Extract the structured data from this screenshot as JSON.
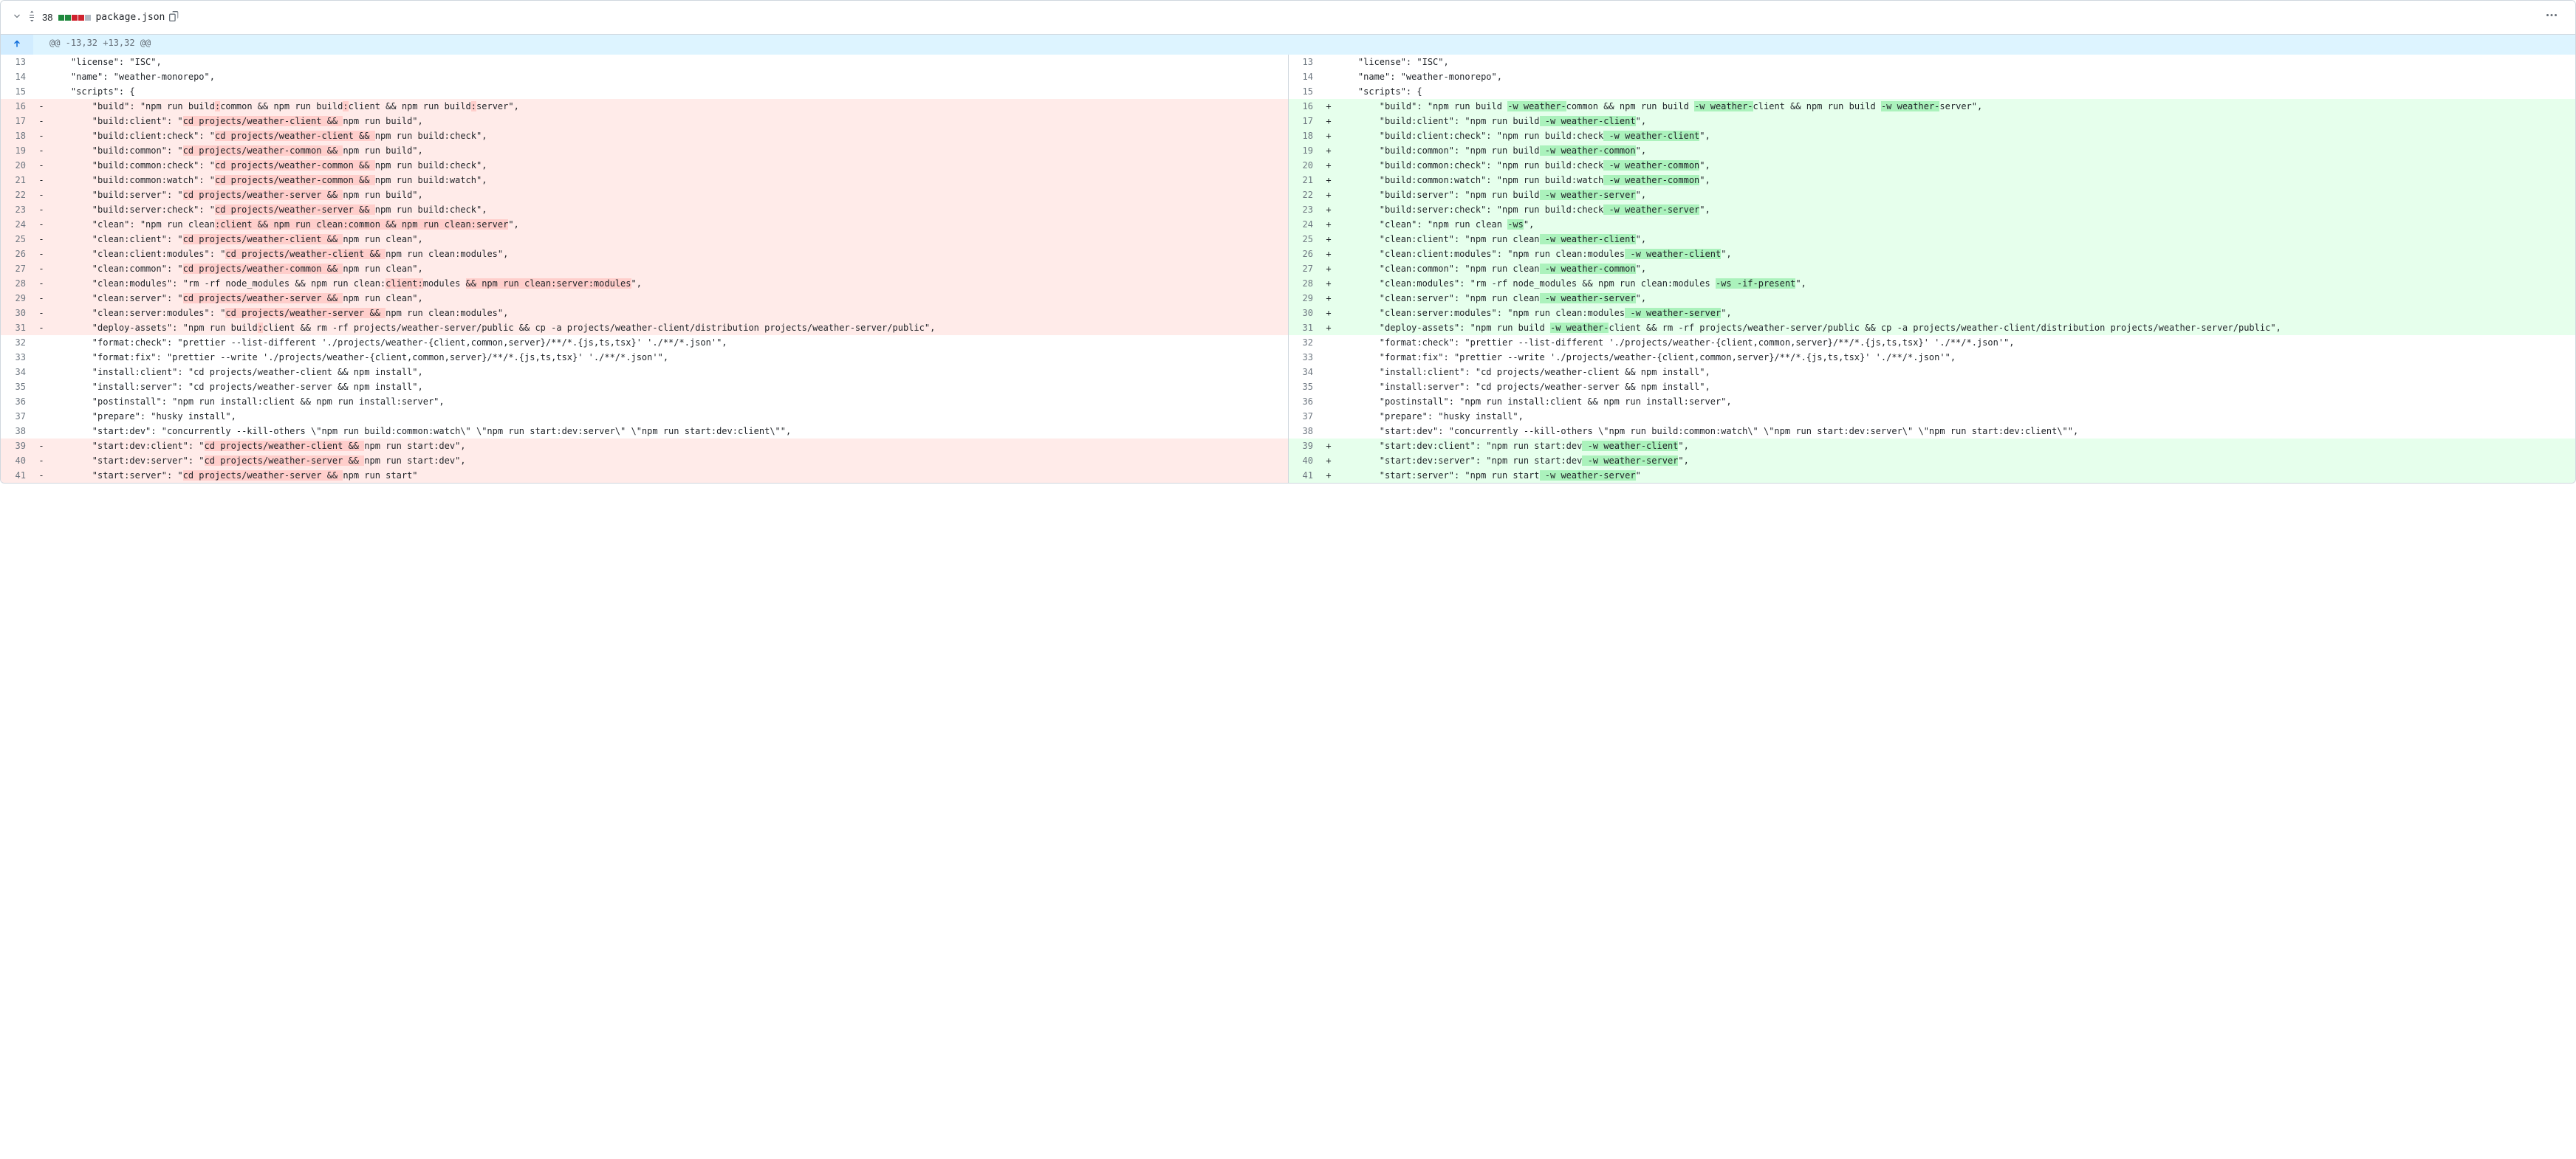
{
  "file": {
    "name": "package.json",
    "changeCount": "38"
  },
  "hunk": {
    "header": "@@ -13,32 +13,32 @@",
    "left": [
      {
        "n": "13",
        "t": "ctx",
        "segs": [
          {
            "t": "    \"license\": \"ISC\","
          }
        ]
      },
      {
        "n": "14",
        "t": "ctx",
        "segs": [
          {
            "t": "    \"name\": \"weather-monorepo\","
          }
        ]
      },
      {
        "n": "15",
        "t": "ctx",
        "segs": [
          {
            "t": "    \"scripts\": {"
          }
        ]
      },
      {
        "n": "16",
        "t": "del",
        "segs": [
          {
            "t": "        \"build\": \"npm run build"
          },
          {
            "t": ":",
            "h": true
          },
          {
            "t": "common && npm run build"
          },
          {
            "t": ":",
            "h": true
          },
          {
            "t": "client && npm run build"
          },
          {
            "t": ":",
            "h": true
          },
          {
            "t": "server\","
          }
        ],
        "m": "-"
      },
      {
        "n": "17",
        "t": "del",
        "segs": [
          {
            "t": "        \"build:client\": \""
          },
          {
            "t": "cd projects/weather-client && ",
            "h": true
          },
          {
            "t": "npm run build\","
          }
        ],
        "m": "-"
      },
      {
        "n": "18",
        "t": "del",
        "segs": [
          {
            "t": "        \"build:client:check\": \""
          },
          {
            "t": "cd projects/weather-client && ",
            "h": true
          },
          {
            "t": "npm run build:check\","
          }
        ],
        "m": "-"
      },
      {
        "n": "19",
        "t": "del",
        "segs": [
          {
            "t": "        \"build:common\": \""
          },
          {
            "t": "cd projects/weather-common && ",
            "h": true
          },
          {
            "t": "npm run build\","
          }
        ],
        "m": "-"
      },
      {
        "n": "20",
        "t": "del",
        "segs": [
          {
            "t": "        \"build:common:check\": \""
          },
          {
            "t": "cd projects/weather-common && ",
            "h": true
          },
          {
            "t": "npm run build:check\","
          }
        ],
        "m": "-"
      },
      {
        "n": "21",
        "t": "del",
        "segs": [
          {
            "t": "        \"build:common:watch\": \""
          },
          {
            "t": "cd projects/weather-common && ",
            "h": true
          },
          {
            "t": "npm run build:watch\","
          }
        ],
        "m": "-"
      },
      {
        "n": "22",
        "t": "del",
        "segs": [
          {
            "t": "        \"build:server\": \""
          },
          {
            "t": "cd projects/weather-server && ",
            "h": true
          },
          {
            "t": "npm run build\","
          }
        ],
        "m": "-"
      },
      {
        "n": "23",
        "t": "del",
        "segs": [
          {
            "t": "        \"build:server:check\": \""
          },
          {
            "t": "cd projects/weather-server && ",
            "h": true
          },
          {
            "t": "npm run build:check\","
          }
        ],
        "m": "-"
      },
      {
        "n": "24",
        "t": "del",
        "segs": [
          {
            "t": "        \"clean\": \"npm run clean"
          },
          {
            "t": ":client && npm run clean:common && npm run clean:server",
            "h": true
          },
          {
            "t": "\","
          }
        ],
        "m": "-"
      },
      {
        "n": "25",
        "t": "del",
        "segs": [
          {
            "t": "        \"clean:client\": \""
          },
          {
            "t": "cd projects/weather-client && ",
            "h": true
          },
          {
            "t": "npm run clean\","
          }
        ],
        "m": "-"
      },
      {
        "n": "26",
        "t": "del",
        "segs": [
          {
            "t": "        \"clean:client:modules\": \""
          },
          {
            "t": "cd projects/weather-client && ",
            "h": true
          },
          {
            "t": "npm run clean:modules\","
          }
        ],
        "m": "-"
      },
      {
        "n": "27",
        "t": "del",
        "segs": [
          {
            "t": "        \"clean:common\": \""
          },
          {
            "t": "cd projects/weather-common && ",
            "h": true
          },
          {
            "t": "npm run clean\","
          }
        ],
        "m": "-"
      },
      {
        "n": "28",
        "t": "del",
        "segs": [
          {
            "t": "        \"clean:modules\": \"rm -rf node_modules && npm run clean:"
          },
          {
            "t": "client:",
            "h": true
          },
          {
            "t": "modules "
          },
          {
            "t": "&& npm run clean:server:modules",
            "h": true
          },
          {
            "t": "\","
          }
        ],
        "m": "-"
      },
      {
        "n": "29",
        "t": "del",
        "segs": [
          {
            "t": "        \"clean:server\": \""
          },
          {
            "t": "cd projects/weather-server && ",
            "h": true
          },
          {
            "t": "npm run clean\","
          }
        ],
        "m": "-"
      },
      {
        "n": "30",
        "t": "del",
        "segs": [
          {
            "t": "        \"clean:server:modules\": \""
          },
          {
            "t": "cd projects/weather-server && ",
            "h": true
          },
          {
            "t": "npm run clean:modules\","
          }
        ],
        "m": "-"
      },
      {
        "n": "31",
        "t": "del",
        "segs": [
          {
            "t": "        \"deploy-assets\": \"npm run build"
          },
          {
            "t": ":",
            "h": true
          },
          {
            "t": "client && rm -rf projects/weather-server/public && cp -a projects/weather-client/distribution projects/weather-server/public\","
          }
        ],
        "m": "-"
      },
      {
        "n": "32",
        "t": "ctx",
        "segs": [
          {
            "t": "        \"format:check\": \"prettier --list-different './projects/weather-{client,common,server}/**/*.{js,ts,tsx}' './**/*.json'\","
          }
        ]
      },
      {
        "n": "33",
        "t": "ctx",
        "segs": [
          {
            "t": "        \"format:fix\": \"prettier --write './projects/weather-{client,common,server}/**/*.{js,ts,tsx}' './**/*.json'\","
          }
        ]
      },
      {
        "n": "34",
        "t": "ctx",
        "segs": [
          {
            "t": "        \"install:client\": \"cd projects/weather-client && npm install\","
          }
        ]
      },
      {
        "n": "35",
        "t": "ctx",
        "segs": [
          {
            "t": "        \"install:server\": \"cd projects/weather-server && npm install\","
          }
        ]
      },
      {
        "n": "36",
        "t": "ctx",
        "segs": [
          {
            "t": "        \"postinstall\": \"npm run install:client && npm run install:server\","
          }
        ]
      },
      {
        "n": "37",
        "t": "ctx",
        "segs": [
          {
            "t": "        \"prepare\": \"husky install\","
          }
        ]
      },
      {
        "n": "38",
        "t": "ctx",
        "segs": [
          {
            "t": "        \"start:dev\": \"concurrently --kill-others \\\"npm run build:common:watch\\\" \\\"npm run start:dev:server\\\" \\\"npm run start:dev:client\\\"\","
          }
        ]
      },
      {
        "n": "39",
        "t": "del",
        "segs": [
          {
            "t": "        \"start:dev:client\": \""
          },
          {
            "t": "cd projects/weather-client && ",
            "h": true
          },
          {
            "t": "npm run start:dev\","
          }
        ],
        "m": "-"
      },
      {
        "n": "40",
        "t": "del",
        "segs": [
          {
            "t": "        \"start:dev:server\": \""
          },
          {
            "t": "cd projects/weather-server && ",
            "h": true
          },
          {
            "t": "npm run start:dev\","
          }
        ],
        "m": "-"
      },
      {
        "n": "41",
        "t": "del",
        "segs": [
          {
            "t": "        \"start:server\": \""
          },
          {
            "t": "cd projects/weather-server && ",
            "h": true
          },
          {
            "t": "npm run start\""
          }
        ],
        "m": "-"
      }
    ],
    "right": [
      {
        "n": "13",
        "t": "ctx",
        "segs": [
          {
            "t": "    \"license\": \"ISC\","
          }
        ]
      },
      {
        "n": "14",
        "t": "ctx",
        "segs": [
          {
            "t": "    \"name\": \"weather-monorepo\","
          }
        ]
      },
      {
        "n": "15",
        "t": "ctx",
        "segs": [
          {
            "t": "    \"scripts\": {"
          }
        ]
      },
      {
        "n": "16",
        "t": "add",
        "segs": [
          {
            "t": "        \"build\": \"npm run build "
          },
          {
            "t": "-w weather-",
            "h": true
          },
          {
            "t": "common && npm run build "
          },
          {
            "t": "-w weather-",
            "h": true
          },
          {
            "t": "client && npm run build "
          },
          {
            "t": "-w weather-",
            "h": true
          },
          {
            "t": "server\","
          }
        ],
        "m": "+"
      },
      {
        "n": "17",
        "t": "add",
        "segs": [
          {
            "t": "        \"build:client\": \"npm run build"
          },
          {
            "t": " -w weather-client",
            "h": true
          },
          {
            "t": "\","
          }
        ],
        "m": "+"
      },
      {
        "n": "18",
        "t": "add",
        "segs": [
          {
            "t": "        \"build:client:check\": \"npm run build:check"
          },
          {
            "t": " -w weather-client",
            "h": true
          },
          {
            "t": "\","
          }
        ],
        "m": "+"
      },
      {
        "n": "19",
        "t": "add",
        "segs": [
          {
            "t": "        \"build:common\": \"npm run build"
          },
          {
            "t": " -w weather-common",
            "h": true
          },
          {
            "t": "\","
          }
        ],
        "m": "+"
      },
      {
        "n": "20",
        "t": "add",
        "segs": [
          {
            "t": "        \"build:common:check\": \"npm run build:check"
          },
          {
            "t": " -w weather-common",
            "h": true
          },
          {
            "t": "\","
          }
        ],
        "m": "+"
      },
      {
        "n": "21",
        "t": "add",
        "segs": [
          {
            "t": "        \"build:common:watch\": \"npm run build:watch"
          },
          {
            "t": " -w weather-common",
            "h": true
          },
          {
            "t": "\","
          }
        ],
        "m": "+"
      },
      {
        "n": "22",
        "t": "add",
        "segs": [
          {
            "t": "        \"build:server\": \"npm run build"
          },
          {
            "t": " -w weather-server",
            "h": true
          },
          {
            "t": "\","
          }
        ],
        "m": "+"
      },
      {
        "n": "23",
        "t": "add",
        "segs": [
          {
            "t": "        \"build:server:check\": \"npm run build:check"
          },
          {
            "t": " -w weather-server",
            "h": true
          },
          {
            "t": "\","
          }
        ],
        "m": "+"
      },
      {
        "n": "24",
        "t": "add",
        "segs": [
          {
            "t": "        \"clean\": \"npm run clean "
          },
          {
            "t": "-ws",
            "h": true
          },
          {
            "t": "\","
          }
        ],
        "m": "+"
      },
      {
        "n": "25",
        "t": "add",
        "segs": [
          {
            "t": "        \"clean:client\": \"npm run clean"
          },
          {
            "t": " -w weather-client",
            "h": true
          },
          {
            "t": "\","
          }
        ],
        "m": "+"
      },
      {
        "n": "26",
        "t": "add",
        "segs": [
          {
            "t": "        \"clean:client:modules\": \"npm run clean:modules"
          },
          {
            "t": " -w weather-client",
            "h": true
          },
          {
            "t": "\","
          }
        ],
        "m": "+"
      },
      {
        "n": "27",
        "t": "add",
        "segs": [
          {
            "t": "        \"clean:common\": \"npm run clean"
          },
          {
            "t": " -w weather-common",
            "h": true
          },
          {
            "t": "\","
          }
        ],
        "m": "+"
      },
      {
        "n": "28",
        "t": "add",
        "segs": [
          {
            "t": "        \"clean:modules\": \"rm -rf node_modules && npm run clean:modules "
          },
          {
            "t": "-ws -if-present",
            "h": true
          },
          {
            "t": "\","
          }
        ],
        "m": "+"
      },
      {
        "n": "29",
        "t": "add",
        "segs": [
          {
            "t": "        \"clean:server\": \"npm run clean"
          },
          {
            "t": " -w weather-server",
            "h": true
          },
          {
            "t": "\","
          }
        ],
        "m": "+"
      },
      {
        "n": "30",
        "t": "add",
        "segs": [
          {
            "t": "        \"clean:server:modules\": \"npm run clean:modules"
          },
          {
            "t": " -w weather-server",
            "h": true
          },
          {
            "t": "\","
          }
        ],
        "m": "+"
      },
      {
        "n": "31",
        "t": "add",
        "segs": [
          {
            "t": "        \"deploy-assets\": \"npm run build "
          },
          {
            "t": "-w weather-",
            "h": true
          },
          {
            "t": "client && rm -rf projects/weather-server/public && cp -a projects/weather-client/distribution projects/weather-server/public\","
          }
        ],
        "m": "+"
      },
      {
        "n": "32",
        "t": "ctx",
        "segs": [
          {
            "t": "        \"format:check\": \"prettier --list-different './projects/weather-{client,common,server}/**/*.{js,ts,tsx}' './**/*.json'\","
          }
        ]
      },
      {
        "n": "33",
        "t": "ctx",
        "segs": [
          {
            "t": "        \"format:fix\": \"prettier --write './projects/weather-{client,common,server}/**/*.{js,ts,tsx}' './**/*.json'\","
          }
        ]
      },
      {
        "n": "34",
        "t": "ctx",
        "segs": [
          {
            "t": "        \"install:client\": \"cd projects/weather-client && npm install\","
          }
        ]
      },
      {
        "n": "35",
        "t": "ctx",
        "segs": [
          {
            "t": "        \"install:server\": \"cd projects/weather-server && npm install\","
          }
        ]
      },
      {
        "n": "36",
        "t": "ctx",
        "segs": [
          {
            "t": "        \"postinstall\": \"npm run install:client && npm run install:server\","
          }
        ]
      },
      {
        "n": "37",
        "t": "ctx",
        "segs": [
          {
            "t": "        \"prepare\": \"husky install\","
          }
        ]
      },
      {
        "n": "38",
        "t": "ctx",
        "segs": [
          {
            "t": "        \"start:dev\": \"concurrently --kill-others \\\"npm run build:common:watch\\\" \\\"npm run start:dev:server\\\" \\\"npm run start:dev:client\\\"\","
          }
        ]
      },
      {
        "n": "39",
        "t": "add",
        "segs": [
          {
            "t": "        \"start:dev:client\": \"npm run start:dev"
          },
          {
            "t": " -w weather-client",
            "h": true
          },
          {
            "t": "\","
          }
        ],
        "m": "+"
      },
      {
        "n": "40",
        "t": "add",
        "segs": [
          {
            "t": "        \"start:dev:server\": \"npm run start:dev"
          },
          {
            "t": " -w weather-server",
            "h": true
          },
          {
            "t": "\","
          }
        ],
        "m": "+"
      },
      {
        "n": "41",
        "t": "add",
        "segs": [
          {
            "t": "        \"start:server\": \"npm run start"
          },
          {
            "t": " -w weather-server",
            "h": true
          },
          {
            "t": "\""
          }
        ],
        "m": "+"
      }
    ]
  }
}
